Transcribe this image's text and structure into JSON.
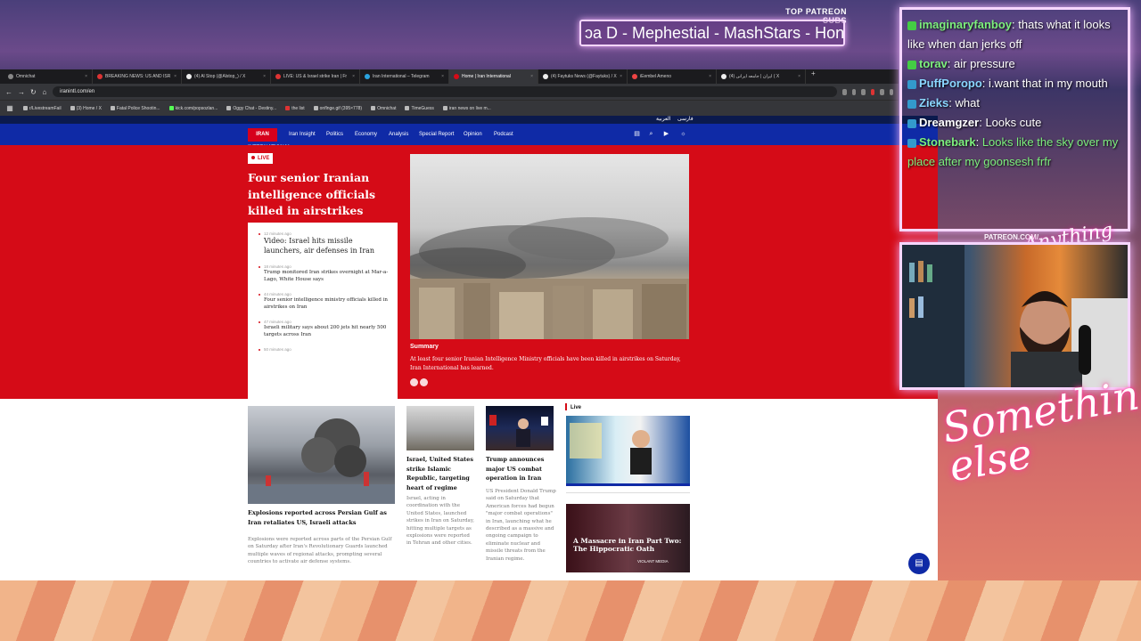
{
  "overlay": {
    "top_patreon_label": "TOP PATREON SUBS",
    "ticker_text": "ɔa D - Mephestial - MashStars - Hones",
    "patreon_url": "PATREON.COM/",
    "brand_small": "Anything else",
    "brand_big": "Something else"
  },
  "browser": {
    "tabs": [
      {
        "label": "Omnichat"
      },
      {
        "label": "BREAKING NEWS: US AND ISR"
      },
      {
        "label": "(4) Al Stop (@Alstop_) / X"
      },
      {
        "label": "LIVE: US & Israel strike Iran | Fr"
      },
      {
        "label": "Iran International – Telegram"
      },
      {
        "label": "Home | Iran International"
      },
      {
        "label": "(4) Faytuks News (@Faytuks) / X"
      },
      {
        "label": "iEembel Ameno"
      },
      {
        "label": "(4) ایران | جامعه ایرانی ( X"
      }
    ],
    "url": "iranintl.com/en",
    "bookmarks": [
      "r/LivestreamFail",
      "(3) Home / X",
      "Fatal Police Shootin...",
      "kick.com/popsozlan...",
      "Oggy Chat - Destiny...",
      "the list",
      "onflnge.gif (395×778)",
      "Omnichat",
      "TimeGuess",
      "iran news on live m..."
    ]
  },
  "site": {
    "lang_links": [
      "فارسی",
      "العربية"
    ],
    "logo": "IRAN INTERNATIONAL",
    "nav": [
      "Iran Insight",
      "Politics",
      "Economy",
      "Analysis",
      "Special Report",
      "Opinion",
      "Podcast"
    ],
    "live_badge": "LIVE",
    "hero_headline": "Four senior Iranian intelligence officials killed in airstrikes",
    "feed": [
      {
        "time": "12 minutes ago",
        "title": "Video: Israel hits missile launchers, air defenses in Iran"
      },
      {
        "time": "18 minutes ago",
        "title": "Trump monitored Iran strikes overnight at Mar-a-Lago, White House says"
      },
      {
        "time": "44 minutes ago",
        "title": "Four senior intelligence ministry officials killed in airstrikes on Iran"
      },
      {
        "time": "47 minutes ago",
        "title": "Israeli military says about 200 jets hit nearly 500 targets across Iran"
      },
      {
        "time": "50 minutes ago",
        "title": ""
      }
    ],
    "summary_label": "Summary",
    "summary_text": "At least four senior Iranian Intelligence Ministry officials have been killed in airstrikes on Saturday, Iran International has learned.",
    "cards": [
      {
        "title": "Explosions reported across Persian Gulf as Iran retaliates US, Israeli attacks",
        "text": "Explosions were reported across parts of the Persian Gulf on Saturday after Iran's Revolutionary Guards launched multiple waves of regional attacks, prompting several countries to activate air defense systems."
      },
      {
        "title": "Israel, United States strike Islamic Republic, targeting heart of regime",
        "text": "Israel, acting in coordination with the United States, launched strikes in Iran on Saturday, hitting multiple targets as explosions were reported in Tehran and other cities."
      },
      {
        "title": "Trump announces major US combat operation in Iran",
        "text": "US President Donald Trump said on Saturday that American forces had begun \"major combat operations\" in Iran, launching what he described as a massive and ongoing campaign to eliminate nuclear and missile threats from the Iranian regime."
      }
    ],
    "live_tag": "Live",
    "promo_title": "A Massacre in Iran Part Two: The Hippocratic Oath",
    "promo_brand": "VIOLANT MEDIA"
  },
  "chat": [
    {
      "user": "imaginaryfanboy",
      "text": "thats what it looks like when dan jerks off",
      "color": "#7df07d"
    },
    {
      "user": "torav",
      "text": "air pressure",
      "color": "#7df07d"
    },
    {
      "user": "PuffPoropo",
      "text": "i.want that in my mouth",
      "color": "#8ad7ff"
    },
    {
      "user": "Zieks",
      "text": "what",
      "color": "#8ad7ff"
    },
    {
      "user": "Dreamgzer",
      "text": "Looks cute",
      "color": "#ffffff"
    },
    {
      "user": "Stonebark",
      "text": "Looks like the sky over my place after my goonsesh frfr",
      "color": "#7df07d"
    }
  ]
}
